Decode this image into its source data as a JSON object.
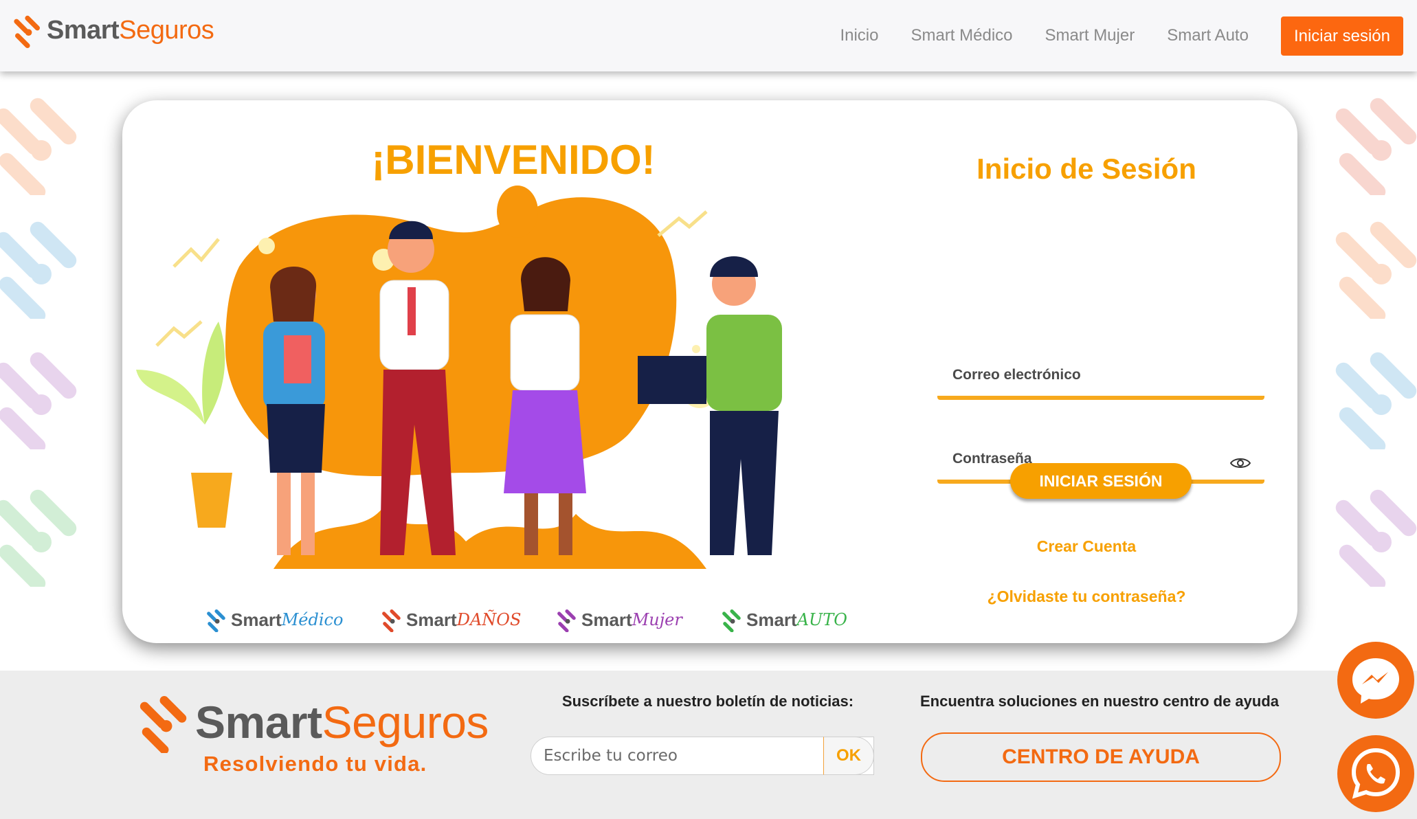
{
  "navbar": {
    "brand": {
      "part1": "Smart",
      "part2": "Seguros"
    },
    "links": [
      "Inicio",
      "Smart Médico",
      "Smart Mujer",
      "Smart Auto"
    ],
    "login_button": "Iniciar sesión"
  },
  "card": {
    "welcome": "¡BIENVENIDO!",
    "logos": [
      {
        "prefix": "Smart",
        "suffix": "Médico",
        "color": "#2a8fd1"
      },
      {
        "prefix": "Smart",
        "suffix": "DAÑOS",
        "color": "#e04a2a"
      },
      {
        "prefix": "Smart",
        "suffix": "Mujer",
        "color": "#9b3fb0"
      },
      {
        "prefix": "Smart",
        "suffix": "AUTO",
        "color": "#39b34a"
      }
    ],
    "login": {
      "title": "Inicio de Sesión",
      "email_label": "Correo electrónico",
      "password_label": "Contraseña",
      "submit": "INICIAR SESIÓN",
      "create_account": "Crear Cuenta",
      "forgot_password": "¿Olvidaste tu contraseña?"
    }
  },
  "footer": {
    "brand": {
      "part1": "Smart",
      "part2": "Seguros"
    },
    "slogan": "Resolviendo tu vida.",
    "newsletter_title": "Suscríbete a nuestro boletín de noticias:",
    "newsletter_placeholder": "Escribe tu correo",
    "newsletter_button": "OK",
    "help_title": "Encuentra soluciones en nuestro centro de ayuda",
    "help_button": "CENTRO DE AYUDA"
  },
  "fabs": {
    "messenger_icon": "messenger-icon",
    "whatsapp_icon": "whatsapp-icon"
  },
  "colors": {
    "orange": "#f36a12",
    "amber": "#f7a000",
    "nav_button": "#fc6710"
  }
}
